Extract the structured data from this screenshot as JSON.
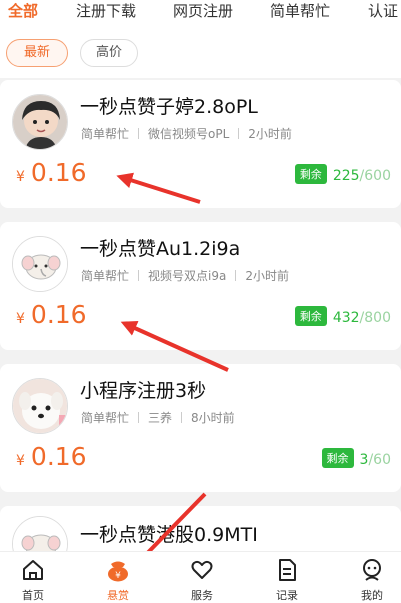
{
  "top_tabs": [
    {
      "label": "全部",
      "active": true
    },
    {
      "label": "注册下载"
    },
    {
      "label": "网页注册"
    },
    {
      "label": "简单帮忙"
    },
    {
      "label": "认证"
    }
  ],
  "filters": [
    {
      "label": "最新",
      "active": true
    },
    {
      "label": "高价"
    }
  ],
  "tasks": [
    {
      "title": "一秒点赞子婷2.8oPL",
      "category": "简单帮忙",
      "platform": "微信视频号oPL",
      "time": "2小时前",
      "currency": "¥",
      "price": "0.16",
      "remaining_label": "剩余",
      "remaining": "225",
      "total": "/600",
      "avatar": "avatar-boy"
    },
    {
      "title": "一秒点赞Au1.2i9a",
      "category": "简单帮忙",
      "platform": "视频号双点i9a",
      "time": "2小时前",
      "currency": "¥",
      "price": "0.16",
      "remaining_label": "剩余",
      "remaining": "432",
      "total": "/800",
      "avatar": "avatar-elephant"
    },
    {
      "title": "小程序注册3秒",
      "category": "简单帮忙",
      "platform": "三养",
      "time": "8小时前",
      "currency": "¥",
      "price": "0.16",
      "remaining_label": "剩余",
      "remaining": "3",
      "total": "/60",
      "avatar": "avatar-dog"
    },
    {
      "title": "一秒点赞港股0.9MTI",
      "avatar": "avatar-elephant"
    }
  ],
  "bottom_nav": [
    {
      "label": "首页",
      "icon": "home-icon"
    },
    {
      "label": "悬赏",
      "icon": "reward-bag-icon",
      "active": true
    },
    {
      "label": "服务",
      "icon": "heart-icon"
    },
    {
      "label": "记录",
      "icon": "document-icon"
    },
    {
      "label": "我的",
      "icon": "profile-icon"
    }
  ],
  "colors": {
    "accent": "#f06a2a",
    "green": "#2db83d",
    "arrow": "#e8332b"
  }
}
